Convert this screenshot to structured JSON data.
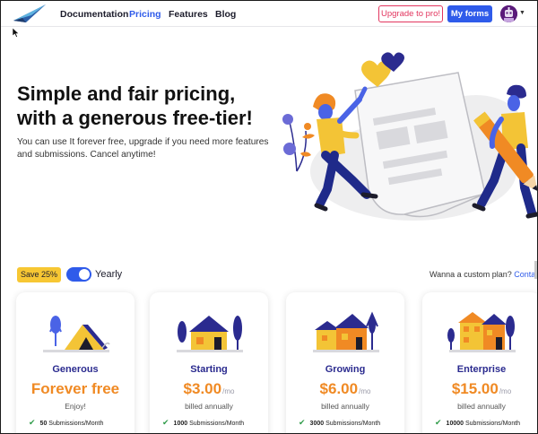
{
  "nav": {
    "links": [
      {
        "label": "Documentation",
        "active": false
      },
      {
        "label": "Pricing",
        "active": true
      },
      {
        "label": "Features",
        "active": false
      },
      {
        "label": "Blog",
        "active": false
      }
    ],
    "upgrade_label": "Upgrade to pro!",
    "forms_label": "My forms",
    "caret_icon": "caret-down-icon"
  },
  "hero": {
    "title": "Simple and fair pricing, with a generous free-tier!",
    "subtitle": "You can use It forever free, upgrade if you need more features and submissions. Cancel anytime!"
  },
  "billing": {
    "save_badge": "Save 25%",
    "toggle_label": "Yearly",
    "toggle_on": true,
    "custom_text": "Wanna a custom plan?",
    "custom_link": "Contact us"
  },
  "plans": [
    {
      "name": "Generous",
      "price": "Forever free",
      "per": "",
      "billed": "Enjoy!",
      "feature_value": "50",
      "feature_text": "Submissions/Month"
    },
    {
      "name": "Starting",
      "price": "$3.00",
      "per": "/mo",
      "billed": "billed annually",
      "feature_value": "1000",
      "feature_text": "Submissions/Month"
    },
    {
      "name": "Growing",
      "price": "$6.00",
      "per": "/mo",
      "billed": "billed annually",
      "feature_value": "3000",
      "feature_text": "Submissions/Month"
    },
    {
      "name": "Enterprise",
      "price": "$15.00",
      "per": "/mo",
      "billed": "billed annually",
      "feature_value": "10000",
      "feature_text": "Submissions/Month"
    }
  ],
  "colors": {
    "accent": "#2f5bea",
    "price": "#f08a24",
    "plan_name": "#2b2b8f",
    "upgrade": "#e2365f",
    "badge": "#f7c733"
  }
}
